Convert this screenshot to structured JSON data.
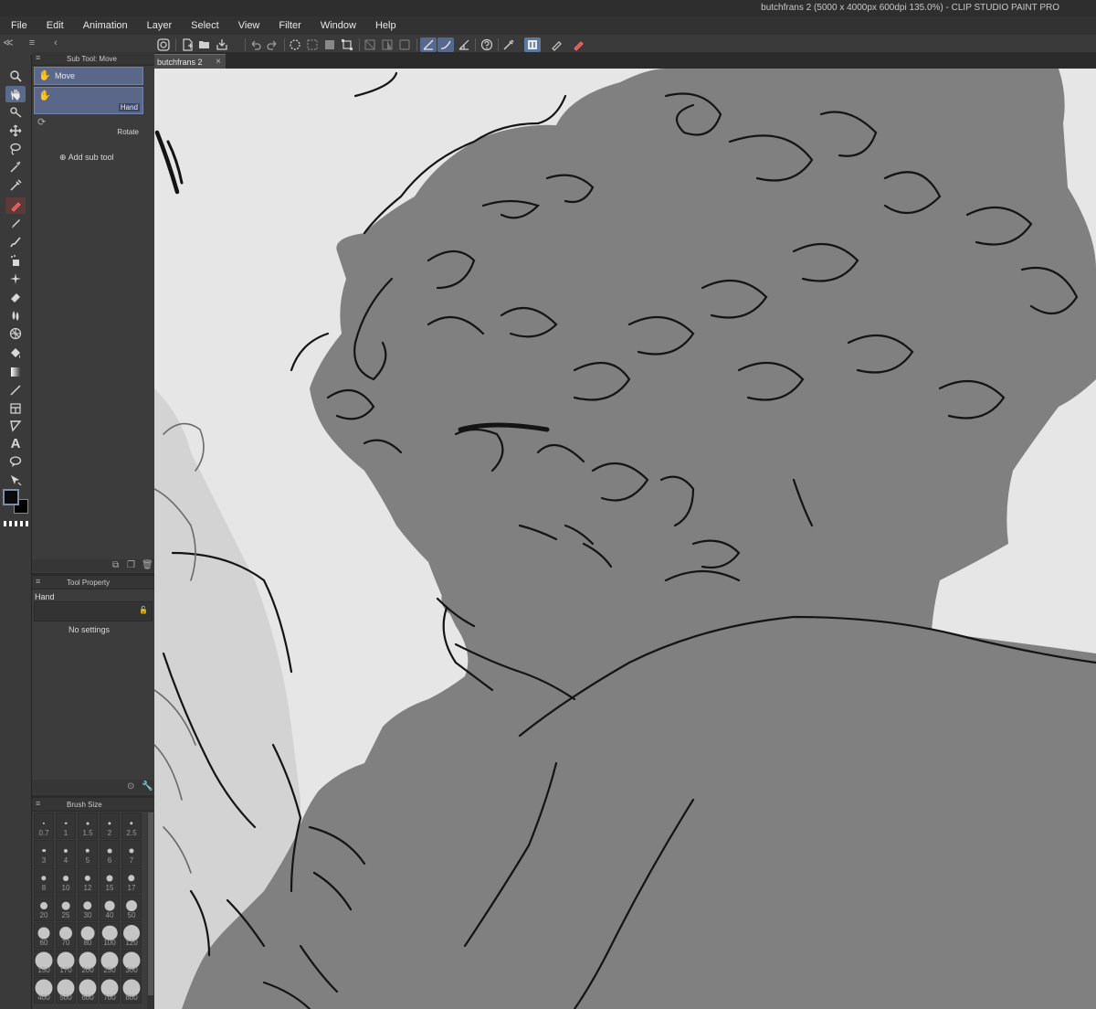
{
  "window": {
    "title": "butchfrans 2 (5000 x 4000px 600dpi 135.0%)  - CLIP STUDIO PAINT PRO"
  },
  "menu": [
    "File",
    "Edit",
    "Animation",
    "Layer",
    "Select",
    "View",
    "Filter",
    "Window",
    "Help"
  ],
  "controls": {
    "collapse": "≪",
    "menu": "≡",
    "expand": "‹"
  },
  "command_bar": {
    "icons": [
      "smartphone-icon",
      "new-file-icon",
      "open-icon",
      "save-icon",
      "undo-icon",
      "redo-icon",
      "clear-icon",
      "cut-icon",
      "transform-icon",
      "deselect-icon",
      "invert-selection-icon",
      "selection-border-icon",
      "snap-ruler-icon",
      "snap-special-ruler-icon",
      "snap-grid-icon",
      "help-icon",
      "eyedropper-icon",
      "settings-icon",
      "pen-icon"
    ]
  },
  "toolbox": {
    "tools": [
      "zoom",
      "hand",
      "operation",
      "move",
      "lasso",
      "auto-select",
      "eyedropper",
      "pen",
      "pencil",
      "brush",
      "airbrush",
      "decoration",
      "eraser",
      "blend",
      "figure",
      "fill",
      "gradient",
      "line",
      "frame",
      "ruler",
      "text",
      "balloon",
      "correct-line"
    ],
    "active_tools": [
      "hand",
      "pen"
    ],
    "colors": {
      "main": "#0b0b0b",
      "sub": "#000000"
    }
  },
  "subtool_panel": {
    "title": "Sub Tool: Move",
    "tab": "Move",
    "items": [
      "Hand",
      "Rotate"
    ],
    "selected": "Hand",
    "add_label": "Add sub tool"
  },
  "tool_property": {
    "title": "Tool Property",
    "tool_name": "Hand",
    "empty_message": "No settings"
  },
  "brush_size": {
    "title": "Brush Size",
    "sizes": [
      "0.7",
      "1",
      "1.5",
      "2",
      "2.5",
      "3",
      "4",
      "5",
      "6",
      "7",
      "8",
      "10",
      "12",
      "15",
      "17",
      "20",
      "25",
      "30",
      "40",
      "50",
      "60",
      "70",
      "80",
      "100",
      "120",
      "150",
      "170",
      "200",
      "250",
      "300",
      "400",
      "500",
      "600",
      "700",
      "800"
    ]
  },
  "document": {
    "tab_label": "butchfrans 2",
    "close": "×"
  },
  "colors": {
    "accent": "#5b6a8a",
    "canvas_bg": "#e6e6e6",
    "fill_gray": "#808080",
    "line": "#141414"
  }
}
